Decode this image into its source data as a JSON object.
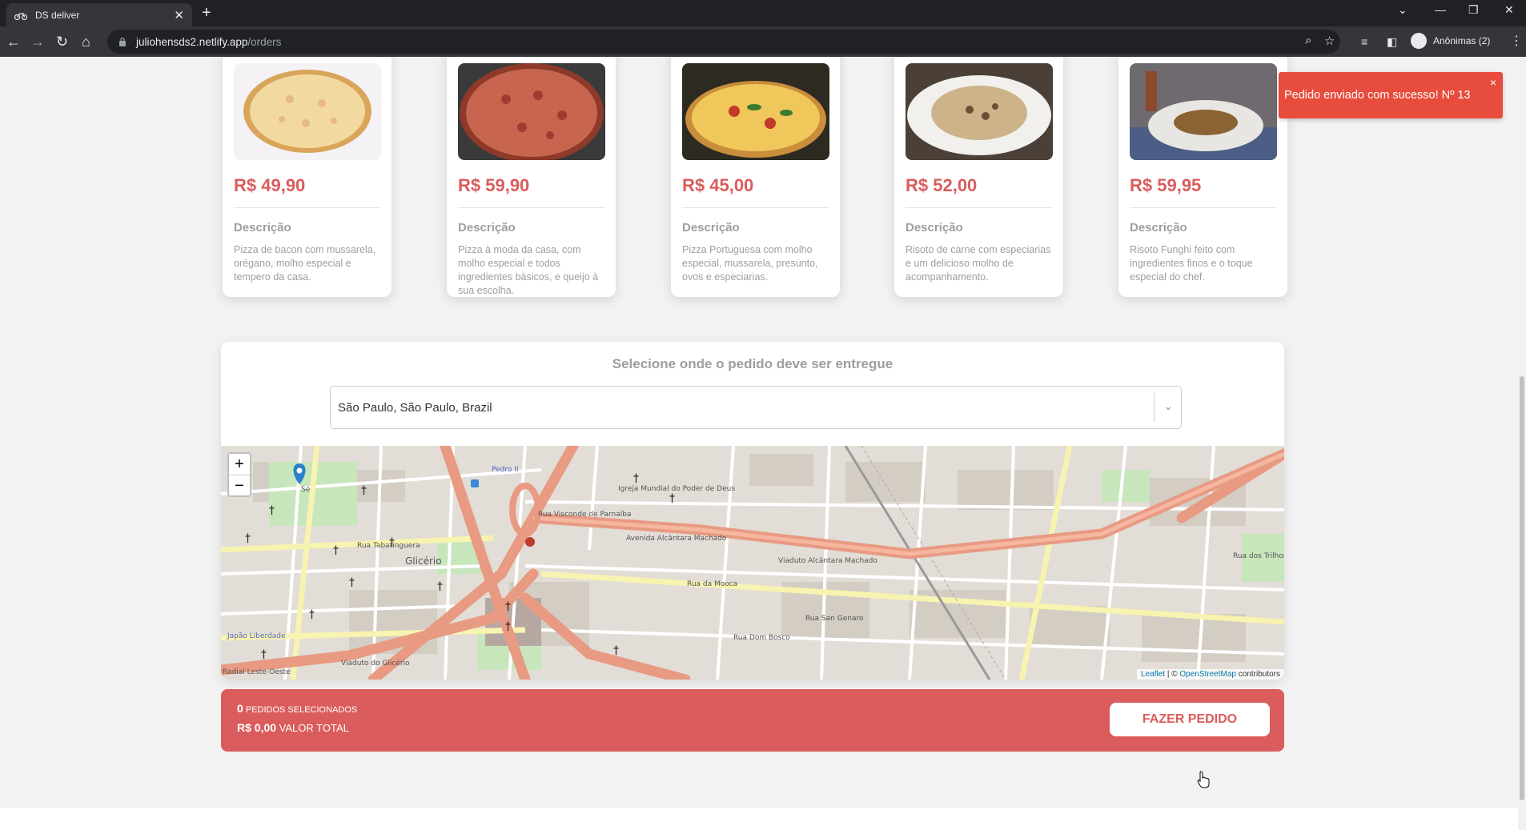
{
  "browser": {
    "tab_title": "DS deliver",
    "url_host": "juliohensds2.netlify.app",
    "url_path": "/orders",
    "profile_label": "Anônimas (2)"
  },
  "products": [
    {
      "price": "R$ 49,90",
      "desc_title": "Descrição",
      "description": "Pizza de bacon com mussarela, orégano, molho especial e tempero da casa."
    },
    {
      "price": "R$ 59,90",
      "desc_title": "Descrição",
      "description": "Pizza à moda da casa, com molho especial e todos ingredientes básicos, e queijo à sua escolha."
    },
    {
      "price": "R$ 45,00",
      "desc_title": "Descrição",
      "description": "Pizza Portuguesa com molho especial, mussarela, presunto, ovos e especiarias."
    },
    {
      "price": "R$ 52,00",
      "desc_title": "Descrição",
      "description": "Risoto de carne com especiarias e um delicioso molho de acompanhamento."
    },
    {
      "price": "R$ 59,95",
      "desc_title": "Descrição",
      "description": "Risoto Funghi feito com ingredientes finos e o toque especial do chef."
    }
  ],
  "location": {
    "title": "Selecione onde o pedido deve ser entregue",
    "selected": "São Paulo, São Paulo, Brazil"
  },
  "map": {
    "zoom_in": "+",
    "zoom_out": "−",
    "attrib_leaflet": "Leaflet",
    "attrib_sep": " | © ",
    "attrib_osm": "OpenStreetMap",
    "attrib_suffix": " contributors",
    "labels": {
      "se": "Sé",
      "liberdade": "Japão Liberdade",
      "glicerio": "Glicério",
      "pedro": "Pedro II",
      "tabatinguera": "Rua Tabatinguera",
      "mooca": "Rua da Mooca",
      "alcantara": "Avenida Alcântara Machado",
      "viaduto": "Viaduto Alcântara Machado",
      "parnaiba": "Rua Visconde de Parnaíba",
      "igreja": "Igreja Mundial do Poder de Deus",
      "trilhos": "Rua dos Trilhos",
      "leste_oeste": "Radial Leste-Oeste",
      "viaduto_glicerio": "Viaduto do Glicério",
      "dom_bosco": "Rua Dom Bosco",
      "san_genaro": "Rua San Genaro"
    }
  },
  "footer": {
    "count": "0",
    "count_label": "PEDIDOS SELECIONADOS",
    "total": "R$ 0,00",
    "total_label": "VALOR TOTAL",
    "button": "FAZER PEDIDO"
  },
  "toast": {
    "message": "Pedido enviado com sucesso! Nº 13",
    "close": "×"
  },
  "colors": {
    "accent": "#da5c5c",
    "toast": "#e74c3c"
  }
}
